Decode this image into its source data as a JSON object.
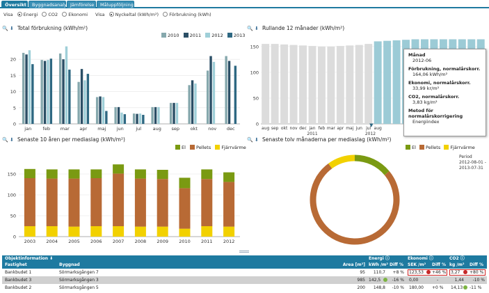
{
  "tabs": [
    "Översikt",
    "Byggnadsanalys",
    "Jämförelse",
    "Måluppföljning"
  ],
  "options": {
    "visa1_label": "Visa",
    "energi": "Energi",
    "co2": "CO2",
    "ekonomi": "Ekonomi",
    "visa2_label": "Visa",
    "nyckeltal": "Nyckeltal  (kWh/m²)",
    "forbrukning": "Förbrukning  (kWh)"
  },
  "panels": {
    "total_title": "Total förbrukning (kWh/m²)",
    "rolling_title": "Rullande 12 månader (kWh/m²)",
    "ten_years_title": "Senaste 10 åren per mediaslag (kWh/m²)",
    "twelve_months_title": "Senaste tolv månaderna per mediaslag (kWh/m²)"
  },
  "tooltip": {
    "manad_label": "Månad",
    "manad_value": "2012-06",
    "forb_label": "Förbrukning, normalårskorr.",
    "forb_value": "164,06 kWh/m²",
    "ekon_label": "Ekonomi, normalårskorr.",
    "ekon_value": "33,99 kr/m²",
    "co2_label": "CO2, normalårskorr.",
    "co2_value": "3,83 kg/m²",
    "metod_label": "Metod för normalårskorrigering",
    "metod_value": "Energiindex"
  },
  "period": {
    "label": "Period",
    "from": "2012-08-01 -",
    "to": "2013-07-31"
  },
  "colors": {
    "y2010": "#86a8ad",
    "y2011": "#2b4f66",
    "y2012": "#9fcfd8",
    "y2013": "#2e6882",
    "rolling_grey": "#dcdcdc",
    "rolling_teal": "#9ccbd6",
    "el": "#7a9a12",
    "pellets": "#b86a35",
    "fjarrvarme": "#f2d100"
  },
  "chart_data": [
    {
      "type": "bar",
      "title": "Total förbrukning (kWh/m²)",
      "categories": [
        "jan",
        "feb",
        "mar",
        "apr",
        "maj",
        "jun",
        "jul",
        "aug",
        "sep",
        "okt",
        "nov",
        "dec"
      ],
      "series": [
        {
          "name": "2010",
          "values": [
            22,
            19.8,
            21.8,
            13,
            8.3,
            5.2,
            3.2,
            5.2,
            6.5,
            12,
            16.5,
            21
          ]
        },
        {
          "name": "2011",
          "values": [
            21.5,
            19.5,
            20,
            17,
            8.5,
            5.2,
            3.1,
            5.2,
            6.5,
            13.5,
            21,
            19.5
          ]
        },
        {
          "name": "2012",
          "values": [
            22.8,
            19.8,
            24,
            13.5,
            8.3,
            3.5,
            3.2,
            5.2,
            6.5,
            12.5,
            19.2,
            null
          ]
        },
        {
          "name": "2013",
          "values": [
            18.5,
            20.2,
            16.8,
            15.5,
            4,
            3,
            2.8,
            null,
            null,
            null,
            null,
            18
          ]
        }
      ],
      "ylim": [
        0,
        25
      ],
      "yticks": [
        0,
        5,
        10,
        15,
        20
      ],
      "legend": "top-right"
    },
    {
      "type": "bar",
      "title": "Rullande 12 månader (kWh/m²)",
      "categories": [
        "aug",
        "sep",
        "okt",
        "nov",
        "dec",
        "jan",
        "feb",
        "mar",
        "apr",
        "maj",
        "jun",
        "jul",
        "aug",
        "sep",
        "okt",
        "nov",
        "dec",
        "jan",
        "feb",
        "mar",
        "apr",
        "maj",
        "jun",
        "jul"
      ],
      "year_labels": [
        "2011",
        "2012"
      ],
      "values": [
        155,
        155,
        154,
        153,
        152,
        151,
        150,
        150,
        151,
        152,
        153,
        155,
        160,
        161,
        162,
        163,
        164,
        164,
        164,
        164,
        164,
        164,
        164,
        164
      ],
      "ylim": [
        0,
        170
      ],
      "yticks": [
        0,
        50,
        100,
        150
      ]
    },
    {
      "type": "bar",
      "title": "Senaste 10 åren per mediaslag (kWh/m²)",
      "categories": [
        "2003",
        "2004",
        "2005",
        "2006",
        "2007",
        "2008",
        "2009",
        "2010",
        "2011",
        "2012"
      ],
      "series": [
        {
          "name": "El",
          "values": [
            22,
            22,
            22,
            21,
            22,
            22,
            22,
            25,
            23,
            23
          ]
        },
        {
          "name": "Pellets",
          "values": [
            115,
            114,
            115,
            115,
            126,
            115,
            114,
            97,
            113,
            107
          ]
        },
        {
          "name": "Fjärrvärme",
          "values": [
            25,
            25,
            24,
            25,
            25,
            24,
            24,
            19,
            25,
            24
          ]
        }
      ],
      "ylim": [
        0,
        200
      ],
      "yticks": [
        0,
        50,
        100,
        150
      ],
      "legend": "top-right"
    },
    {
      "type": "pie",
      "title": "Senaste tolv månaderna per mediaslag (kWh/m²)",
      "labels": [
        "El",
        "Pellets",
        "Fjärrvärme"
      ],
      "values": [
        14,
        76,
        10
      ],
      "legend": "top-left"
    }
  ],
  "table": {
    "header1": {
      "objekt": "Objektinformation",
      "energi": "Energi",
      "ekonomi": "Ekonomi",
      "co2": "CO2"
    },
    "header2": {
      "fastighet": "Fastighet",
      "byggnad": "Byggnad",
      "area": "Area [m²]",
      "e_val": "kWh /m²",
      "e_diff": "Diff %",
      "k_val": "SEK /m²",
      "k_diff": "Diff %",
      "c_val": "kg /m²",
      "c_diff": "Diff %"
    },
    "rows": [
      {
        "fastighet": "Bankbudet 1",
        "byggnad": "Sörmarksgången 7",
        "area": "95",
        "e_val": "110,7",
        "e_diff": "+8 %",
        "k_val": "123,53",
        "k_diff": "+46 %",
        "c_val": "3,27",
        "c_diff": "+80 %"
      },
      {
        "fastighet": "Bankbudet 3",
        "byggnad": "Sörmarksgången 3",
        "area": "985",
        "e_val": "142,5",
        "e_diff": "-16 %",
        "k_val": "0,00",
        "k_diff": "-",
        "c_val": "1,44",
        "c_diff": "-10 %"
      },
      {
        "fastighet": "Bankbudet 2",
        "byggnad": "Sörmarksgången 5",
        "area": "200",
        "e_val": "148,8",
        "e_diff": "-10 %",
        "k_val": "180,00",
        "k_diff": "+0 %",
        "c_val": "14,13",
        "c_diff": "-11 %"
      }
    ]
  }
}
